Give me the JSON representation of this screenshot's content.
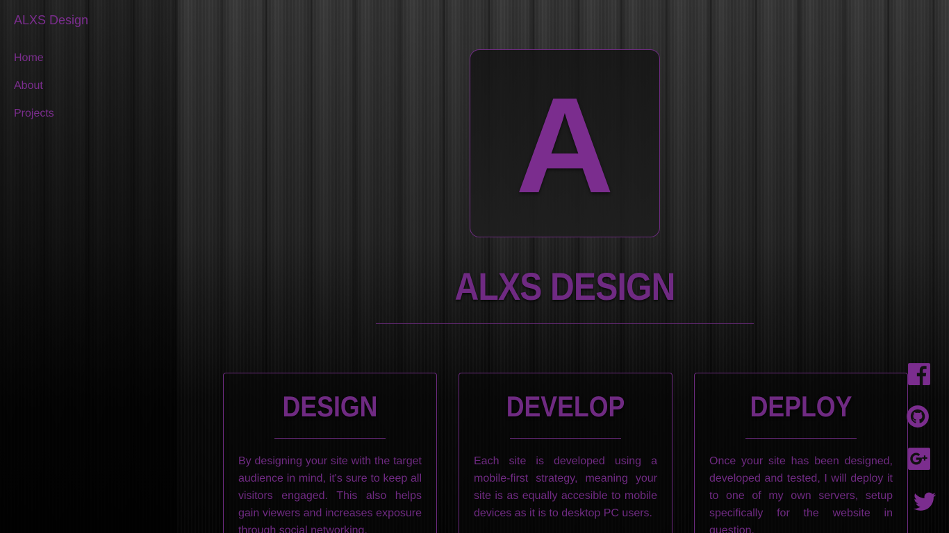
{
  "sidebar": {
    "brand": "ALXS Design",
    "items": [
      {
        "label": "Home"
      },
      {
        "label": "About"
      },
      {
        "label": "Projects"
      }
    ]
  },
  "hero": {
    "logo_letter": "A",
    "title": "ALXS DESIGN"
  },
  "cards": [
    {
      "title": "DESIGN",
      "text": "By designing your site with the target audience in mind, it's sure to keep all visitors engaged. This also helps gain viewers and increases exposure through social networking."
    },
    {
      "title": "DEVELOP",
      "text": "Each site is developed using a mobile-first strategy, meaning your site is as equally accesible to mobile devices as it is to desktop PC users."
    },
    {
      "title": "DEPLOY",
      "text": "Once your site has been designed, developed and tested, I will deploy it to one of my own servers, setup specifically for the website in question."
    }
  ],
  "social": [
    {
      "icon": "facebook-icon"
    },
    {
      "icon": "github-icon"
    },
    {
      "icon": "google-plus-icon"
    },
    {
      "icon": "twitter-icon"
    }
  ],
  "colors": {
    "accent": "#7b2d8e",
    "background": "#111111"
  }
}
